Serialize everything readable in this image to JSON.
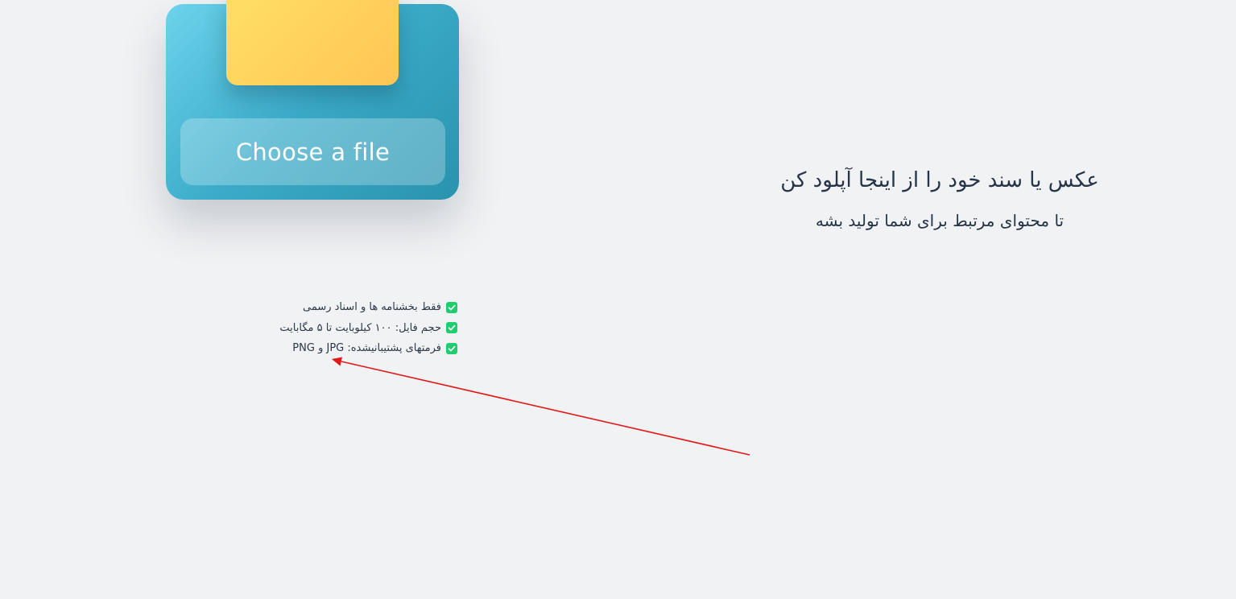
{
  "upload": {
    "button_label": "Choose a file"
  },
  "heading": {
    "title": "عکس یا سند خود را از اینجا آپلود کن",
    "subtitle": "تا محتوای مرتبط برای شما تولید بشه"
  },
  "requirements": [
    {
      "text": "فقط بخشنامه ها و اسناد رسمی",
      "icon": "check-icon"
    },
    {
      "text": "حجم فایل: ۱۰۰ کیلوبایت تا ۵ مگابایت",
      "icon": "check-icon"
    },
    {
      "text": "فرمتهای پشتیبانیشده: JPG و PNG",
      "icon": "check-icon"
    }
  ],
  "colors": {
    "background": "#f1f2f4",
    "card_gradient_start": "#6dd3ec",
    "card_gradient_end": "#2a93ae",
    "folder": "#ffd35e",
    "check": "#1fcc6e",
    "arrow": "#e01818",
    "heading_text": "#253447"
  }
}
